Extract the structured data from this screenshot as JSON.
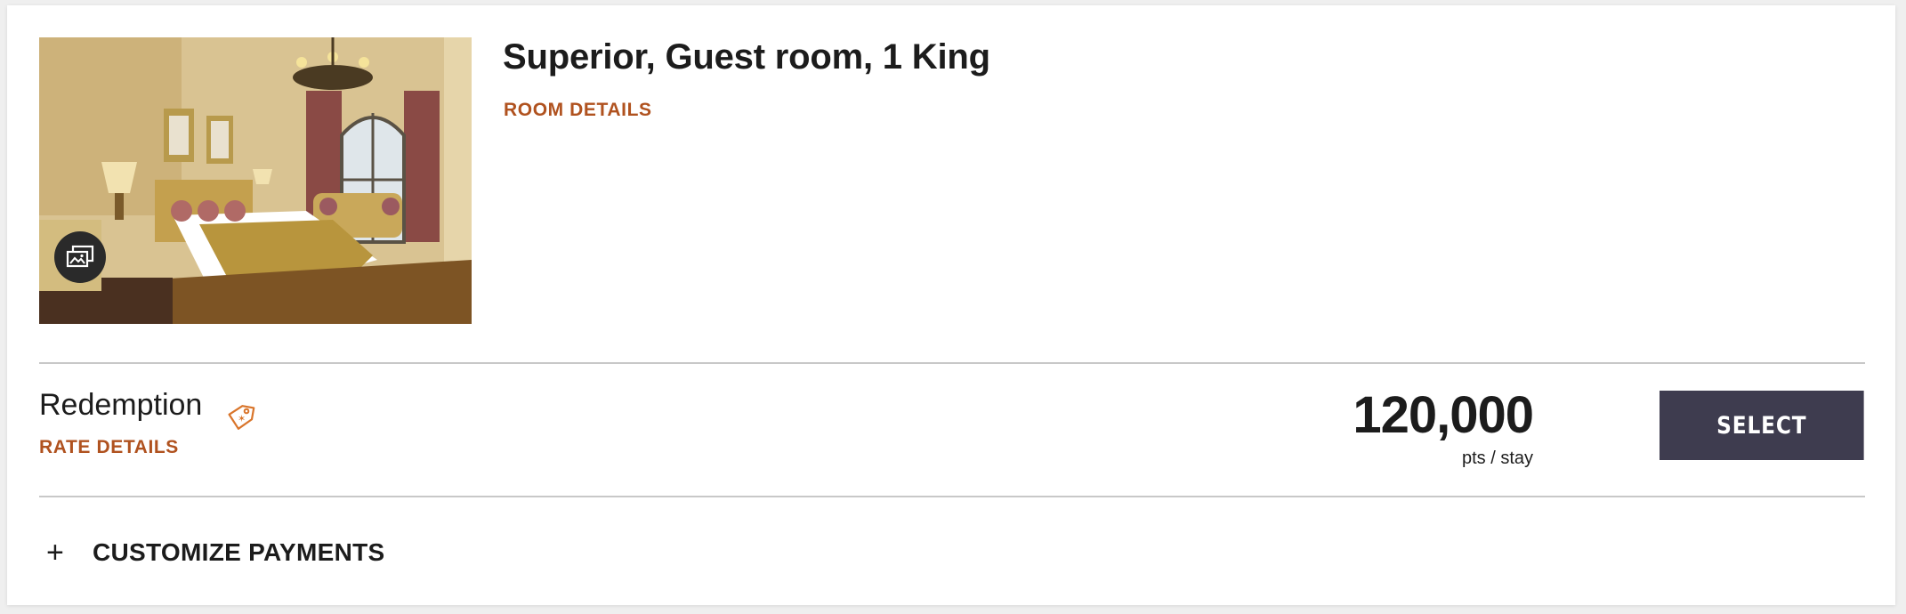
{
  "room": {
    "title": "Superior, Guest room, 1 King",
    "details_link": "ROOM DETAILS",
    "photo_alt": "Hotel room photo",
    "gallery_icon": "photo-gallery-icon"
  },
  "rate": {
    "name": "Redemption",
    "tag_icon": "tag-icon",
    "details_link": "RATE DETAILS",
    "price": "120,000",
    "price_unit": "pts / stay",
    "select_label": "SELECT"
  },
  "payments": {
    "toggle_icon": "plus-icon",
    "label": "CUSTOMIZE PAYMENTS"
  },
  "colors": {
    "accent_link": "#b0521f",
    "select_button": "#3e3c4f",
    "divider": "#c8c8c8"
  }
}
